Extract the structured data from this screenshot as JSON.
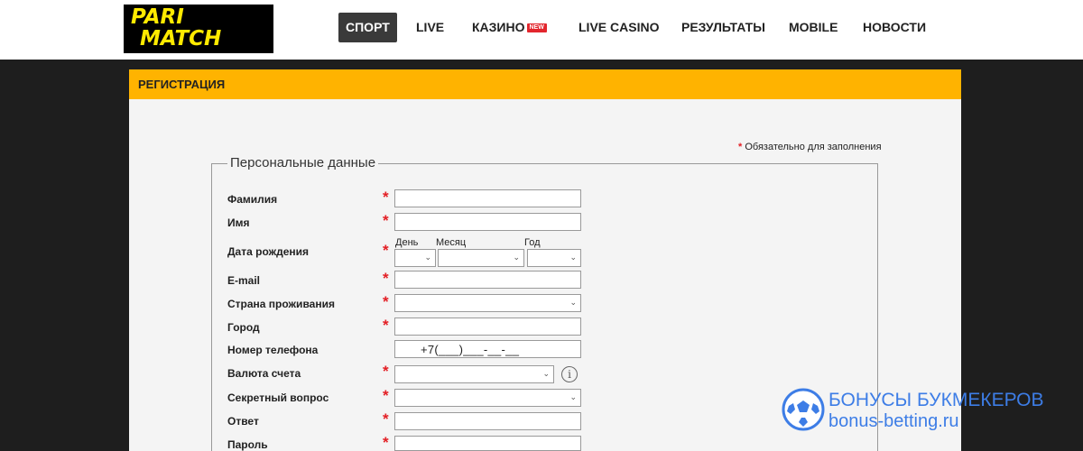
{
  "header": {
    "logo": [
      "PARI",
      "MATCH"
    ],
    "nav": [
      {
        "label": "СПОРТ",
        "active": true
      },
      {
        "label": "LIVE"
      },
      {
        "label": "КАЗИНО",
        "badge": "NEW"
      },
      {
        "label": "LIVE CASINO"
      },
      {
        "label": "РЕЗУЛЬТАТЫ"
      },
      {
        "label": "MOBILE"
      },
      {
        "label": "НОВОСТИ"
      }
    ]
  },
  "panel": {
    "title": "РЕГИСТРАЦИЯ",
    "required_note": "Обязательно для заполнения",
    "required_star": "*",
    "section_legend": "Персональные данные"
  },
  "form": {
    "fields": [
      {
        "label": "Фамилия",
        "required": true,
        "type": "text",
        "value": ""
      },
      {
        "label": "Имя",
        "required": true,
        "type": "text",
        "value": ""
      },
      {
        "label": "Дата рождения",
        "required": true,
        "type": "date"
      },
      {
        "label": "E-mail",
        "required": true,
        "type": "text",
        "value": ""
      },
      {
        "label": "Страна проживания",
        "required": true,
        "type": "select",
        "value": ""
      },
      {
        "label": "Город",
        "required": true,
        "type": "text",
        "value": ""
      },
      {
        "label": "Номер телефона",
        "required": false,
        "type": "phone",
        "mask": "+7(___)___-__-__"
      },
      {
        "label": "Валюта счета",
        "required": true,
        "type": "select",
        "value": ""
      },
      {
        "label": "Секретный вопрос",
        "required": true,
        "type": "select",
        "value": ""
      },
      {
        "label": "Ответ",
        "required": true,
        "type": "text",
        "value": ""
      },
      {
        "label": "Пароль",
        "required": true,
        "type": "text",
        "value": ""
      }
    ],
    "date_parts": {
      "day": "День",
      "month": "Месяц",
      "year": "Год"
    },
    "info_icon": "i"
  },
  "watermark": {
    "line1": "БОНУСЫ БУКМЕКЕРОВ",
    "line2": "bonus-betting.ru",
    "icon": "soccer-ball-icon"
  },
  "colors": {
    "accent": "#ffb300",
    "required": "#e31e24",
    "logo_yellow": "#ffea00",
    "watermark": "#3d7de6"
  }
}
